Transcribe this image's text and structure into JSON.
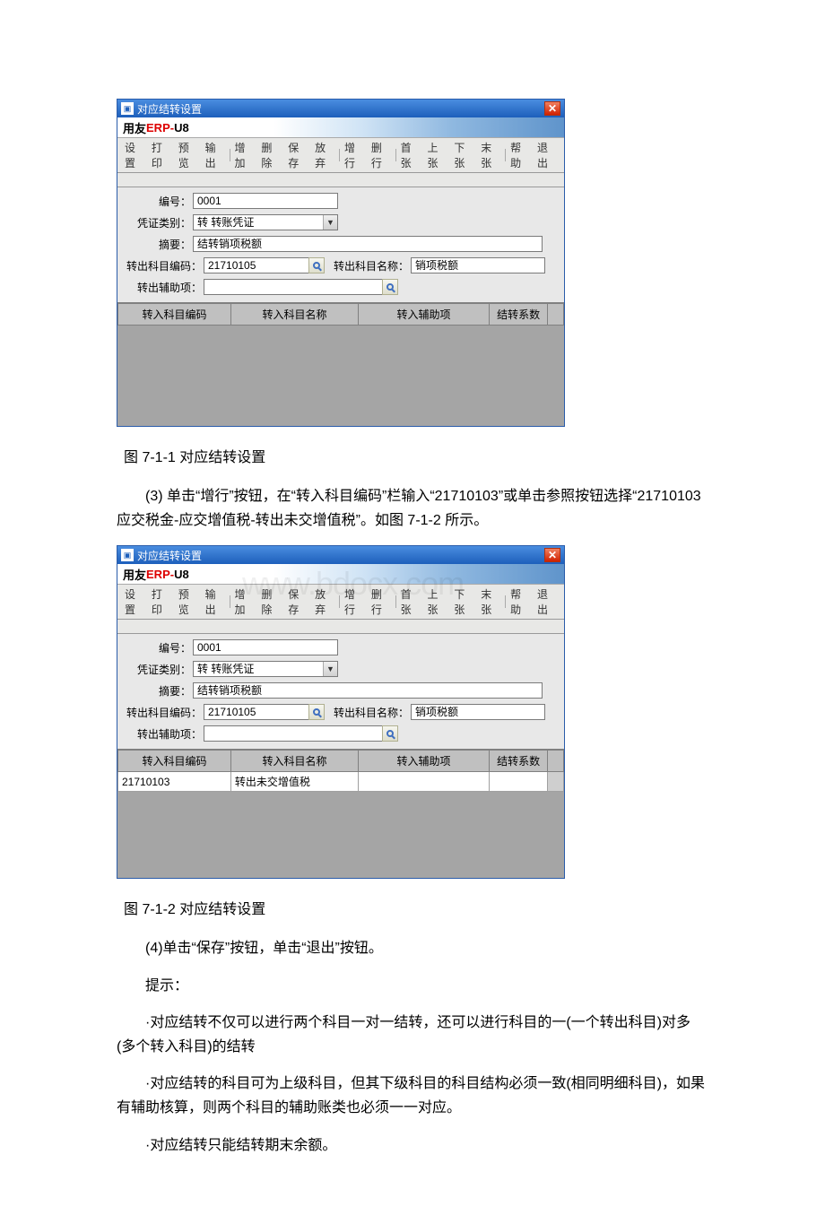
{
  "window_title": "对应结转设置",
  "brand": {
    "prefix": "用友",
    "erp": "ERP-",
    "suffix": "U8"
  },
  "toolbar": {
    "set": "设置",
    "print": "打印",
    "preview": "预览",
    "export": "输出",
    "add": "增加",
    "del": "删除",
    "save": "保存",
    "abandon": "放弃",
    "addrow": "增行",
    "delrow": "删行",
    "first": "首张",
    "prev": "上张",
    "next": "下张",
    "last": "末张",
    "help": "帮助",
    "exit": "退出"
  },
  "labels": {
    "code": "编号：",
    "vouchertype": "凭证类别：",
    "summary": "摘要：",
    "out_code": "转出科目编码：",
    "out_name": "转出科目名称：",
    "out_aux": "转出辅助项："
  },
  "form1": {
    "code": "0001",
    "vouchertype": "转 转账凭证",
    "summary": "结转销项税额",
    "out_code": "21710105",
    "out_name": "销项税额",
    "out_aux": ""
  },
  "columns": {
    "in_code": "转入科目编码",
    "in_name": "转入科目名称",
    "in_aux": "转入辅助项",
    "ratio": "结转系数"
  },
  "caption1": "图 7-1-1 对应结转设置",
  "para1": "(3) 单击“增行”按钮，在“转入科目编码”栏输入“21710103”或单击参照按钮选择“21710103 应交税金-应交增值税-转出未交增值税”。如图 7-1-2 所示。",
  "form2_row": {
    "in_code": "21710103",
    "in_name": "转出未交增值税",
    "in_aux": "",
    "ratio": ""
  },
  "caption2": "图 7-1-2 对应结转设置",
  "para2": "(4)单击“保存”按钮，单击“退出”按钮。",
  "para3": "提示：",
  "bullet1": "·对应结转不仅可以进行两个科目一对一结转，还可以进行科目的一(一个转出科目)对多(多个转入科目)的结转",
  "bullet2": "·对应结转的科目可为上级科目，但其下级科目的科目结构必须一致(相同明细科目)，如果有辅助核算，则两个科目的辅助账类也必须一一对应。",
  "bullet3": "·对应结转只能结转期末余额。",
  "watermark": "www.bdocx.com"
}
